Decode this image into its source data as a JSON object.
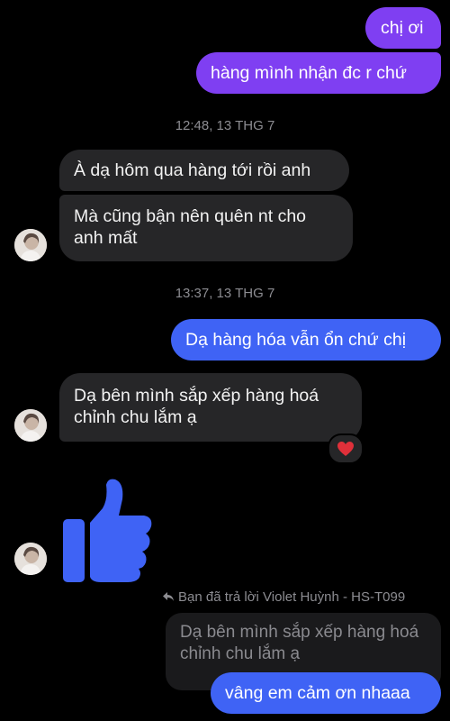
{
  "messages": {
    "out1": "chị ơi",
    "out2": "hàng mình nhận đc r chứ",
    "ts1": "12:48, 13 THG 7",
    "in1": "À dạ hôm qua hàng tới rồi anh",
    "in2_line1": "Mà cũng bận nên quên nt cho",
    "in2_line2": "anh mất",
    "ts2": "13:37, 13 THG 7",
    "out3": "Dạ hàng hóa vẫn ổn chứ chị",
    "in3_line1": "Dạ bên mình sắp xếp hàng hoá",
    "in3_line2": "chỉnh chu lắm ạ",
    "reaction": "❤️",
    "sticker": "thumbs-up",
    "reply_label": "Bạn đã trả lời Violet Huỳnh - HS-T099",
    "quoted_line1": "Dạ bên mình sắp xếp hàng hoá",
    "quoted_line2": "chỉnh chu lắm ạ",
    "out4": "vâng em cảm ơn nhaaa"
  },
  "colors": {
    "outgoing_purple": "#7f3ff2",
    "outgoing_blue": "#3f63f5",
    "incoming": "#262628",
    "timestamp": "#8c8c91",
    "thumbs_up": "#3f63f5",
    "heart": "#e0303a"
  }
}
